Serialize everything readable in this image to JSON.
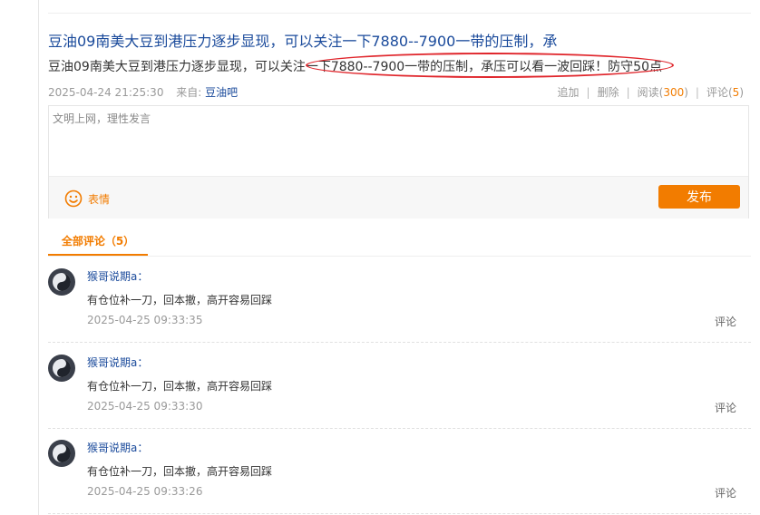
{
  "post": {
    "title": "豆油09南美大豆到港压力逐步显现，可以关注一下7880--7900一带的压制，承",
    "summary": "豆油09南美大豆到港压力逐步显现，可以关注一下7880--7900一带的压制，承压可以看一波回踩！防守50点",
    "time": "2025-04-24 21:25:30",
    "source_label": "来自:",
    "source": "豆油吧",
    "actions": {
      "append": "追加",
      "delete": "删除",
      "read_label": "阅读",
      "read_count": "300",
      "comment_label": "评论",
      "comment_count": "5"
    }
  },
  "editor": {
    "placeholder": "文明上网，理性发言",
    "emoji_label": "表情",
    "submit_label": "发布"
  },
  "tabs": {
    "all_comments": "全部评论（5）"
  },
  "comments": [
    {
      "author": "猴哥说期a：",
      "text": "有仓位补一刀，回本撤，高开容易回踩",
      "time": "2025-04-25 09:33:35",
      "reply": "评论"
    },
    {
      "author": "猴哥说期a：",
      "text": "有仓位补一刀，回本撤，高开容易回踩",
      "time": "2025-04-25 09:33:30",
      "reply": "评论"
    },
    {
      "author": "猴哥说期a：",
      "text": "有仓位补一刀，回本撤，高开容易回踩",
      "time": "2025-04-25 09:33:26",
      "reply": "评论"
    }
  ],
  "colors": {
    "accent": "#f27c00",
    "link": "#1a4a9b",
    "highlight": "#e0262c"
  }
}
